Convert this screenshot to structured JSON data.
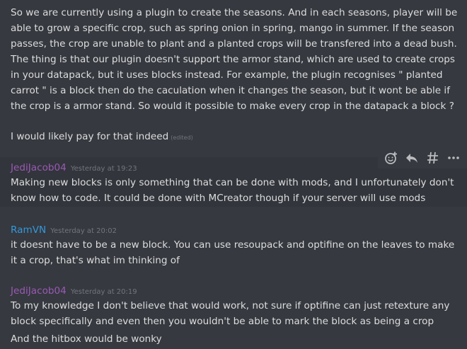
{
  "messages": [
    {
      "lines": [
        "So we are currently using a plugin to create the seasons. And in each seasons, player will be",
        "able to grow a specific crop, such as spring onion in spring, mango in summer. If the season",
        "passes, the crop are unable to plant and a planted crops will be transfered into a dead bush.",
        "The thing is that our plugin doesn't support the armor stand, which are used to create crops",
        "in your datapack, but it uses blocks instead. For example, the plugin recognises \" planted",
        "carrot \" is a block then do the caculation when it changes the season, but it wont be able if",
        "the crop is a armor stand. So would it possible to make every crop in the datapack a block ?"
      ],
      "followup": "I would likely pay for that indeed",
      "edited": "(edited)"
    },
    {
      "username": "JediJacob04",
      "username_color": "#9b59b6",
      "timestamp": "Yesterday at 19:23",
      "lines": [
        "Making new blocks is only something that can be done with mods, and I unfortunately don't",
        "know how to code. It could be done with MCreator though if your server will use mods"
      ]
    },
    {
      "username": "RamVN",
      "username_color": "#3498db",
      "timestamp": "Yesterday at 20:02",
      "lines": [
        "it doesnt have to be a new block. You can use resoupack and optifine on the leaves to make",
        "it a crop, that's what im thinking of"
      ]
    },
    {
      "username": "JediJacob04",
      "username_color": "#9b59b6",
      "timestamp": "Yesterday at 20:19",
      "lines": [
        "To my knowledge I don't believe that would work, not sure if optifine can just retexture any",
        "block specifically and even then you wouldn't be able to mark the block as being a crop"
      ],
      "followup": "And the hitbox would be wonky"
    }
  ],
  "toolbar": {
    "icons": [
      "add-reaction-icon",
      "reply-icon",
      "create-thread-icon",
      "more-icon"
    ],
    "icon_color": "#b9bbbe"
  }
}
